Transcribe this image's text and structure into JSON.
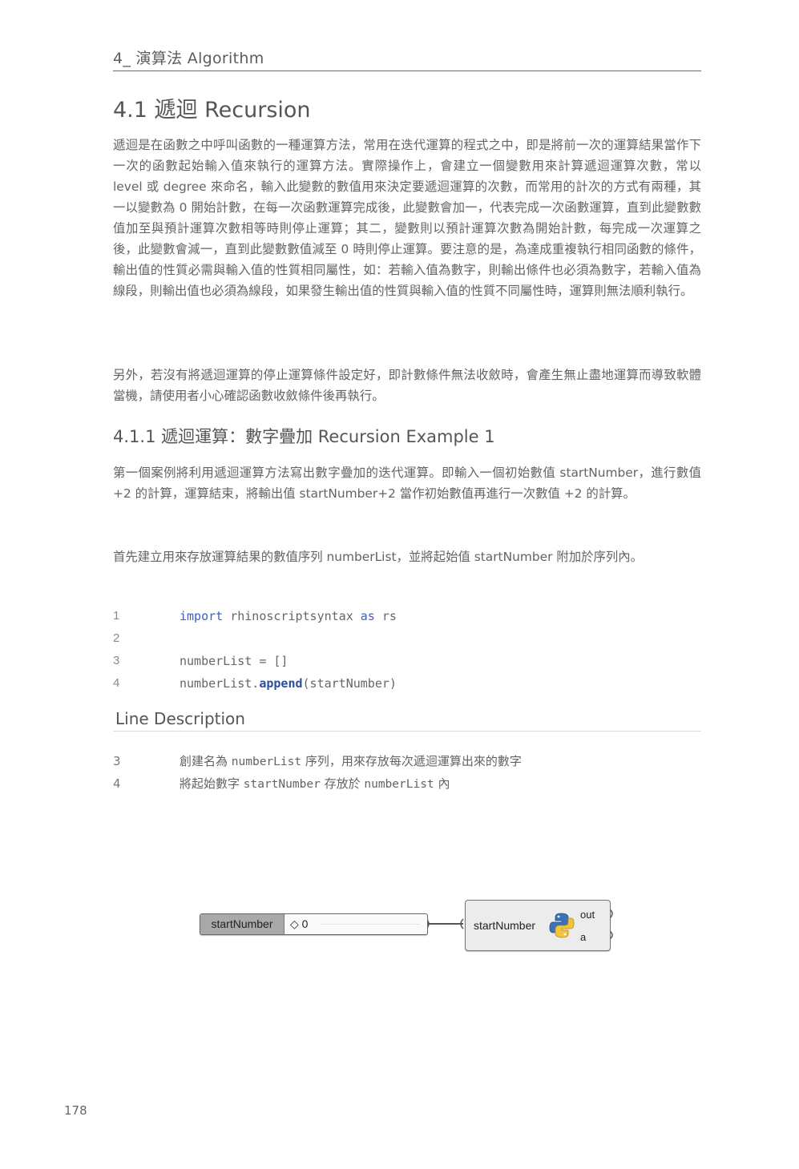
{
  "header": {
    "chapter": "4_ 演算法 Algorithm"
  },
  "section": {
    "title": "4.1 遞迴 Recursion"
  },
  "paragraphs": {
    "p1": "遞迴是在函數之中呼叫函數的一種運算方法，常用在迭代運算的程式之中，即是將前一次的運算結果當作下一次的函數起始輸入值來執行的運算方法。實際操作上，會建立一個變數用來計算遞迴運算次數，常以 level 或 degree 來命名，輸入此變數的數值用來決定要遞迴運算的次數，而常用的計次的方式有兩種，其一以變數為 0 開始計數，在每一次函數運算完成後，此變數會加一，代表完成一次函數運算，直到此變數數值加至與預計運算次數相等時則停止運算；其二，變數則以預計運算次數為開始計數，每完成一次運算之後，此變數會減一，直到此變數數值減至 0 時則停止運算。要注意的是，為達成重複執行相同函數的條件，輸出值的性質必需與輸入值的性質相同屬性，如：若輸入值為數字，則輸出條件也必須為數字，若輸入值為線段，則輸出值也必須為線段，如果發生輸出值的性質與輸入值的性質不同屬性時，運算則無法順利執行。",
    "p2": "另外，若沒有將遞迴運算的停止運算條件設定好，即計數條件無法收斂時，會產生無止盡地運算而導致軟體當機，請使用者小心確認函數收斂條件後再執行。"
  },
  "subsection": {
    "title": "4.1.1 遞迴運算：數字疊加 Recursion Example 1",
    "p1": "第一個案例將利用遞迴運算方法寫出數字疊加的迭代運算。即輸入一個初始數值 startNumber，進行數值 +2 的計算，運算結束，將輸出值 startNumber+2 當作初始數值再進行一次數值 +2 的計算。",
    "p2": "首先建立用來存放運算結果的數值序列 numberList，並將起始值 startNumber 附加於序列內。"
  },
  "code": {
    "lines": [
      {
        "num": "1",
        "kw1": "import",
        "mid": " rhinoscriptsyntax ",
        "kw2": "as",
        "tail": " rs"
      },
      {
        "num": "2"
      },
      {
        "num": "3",
        "text": "numberList = []"
      },
      {
        "num": "4",
        "pre": "numberList.",
        "fn": "append",
        "post": "(startNumber)"
      }
    ]
  },
  "line_description": {
    "title": "Line Description",
    "rows": [
      {
        "num": "3",
        "a": "創建名為 ",
        "code": "numberList",
        "b": " 序列，用來存放每次遞迴運算出來的數字"
      },
      {
        "num": "4",
        "a": "將起始數字 ",
        "code": "startNumber",
        "b": " 存放於 ",
        "code2": "numberList",
        "c": " 內"
      }
    ]
  },
  "grasshopper": {
    "slider_label": "startNumber",
    "slider_value": "◇ 0",
    "component_input": "startNumber",
    "output_1": "out",
    "output_2": "a",
    "wire_color": "#555555",
    "python_blue": "#3b73b8",
    "python_yellow": "#f2c53d"
  },
  "page_number": "178"
}
